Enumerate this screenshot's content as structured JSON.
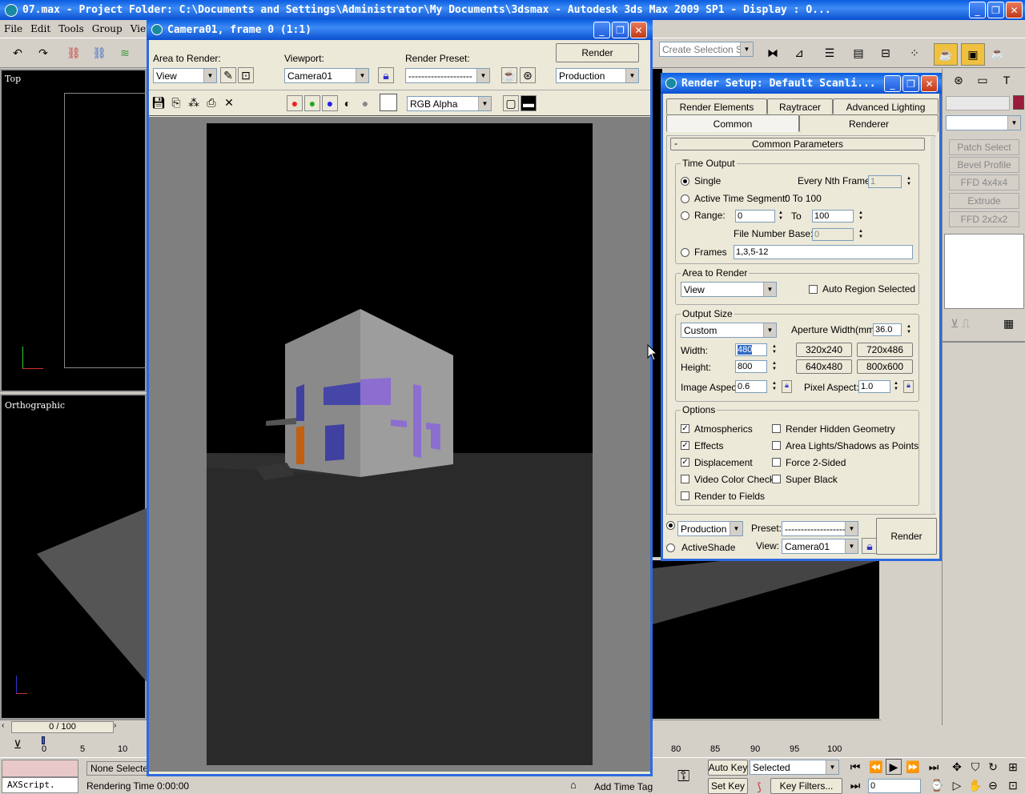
{
  "app": {
    "title": "07.max   - Project Folder: C:\\Documents and Settings\\Administrator\\My Documents\\3dsmax   - Autodesk 3ds Max  2009 SP1    - Display : O..."
  },
  "menu": [
    "File",
    "Edit",
    "Tools",
    "Group",
    "View"
  ],
  "toolbar": {
    "selection_set_placeholder": "Create Selection Set"
  },
  "viewports": {
    "top": "Top",
    "ortho": "Orthographic"
  },
  "side_panel": {
    "buttons": [
      "Patch Select",
      "Bevel Profile",
      "FFD 4x4x4",
      "Extrude",
      "FFD 2x2x2"
    ]
  },
  "frame_window": {
    "title": "Camera01, frame 0 (1:1)",
    "area_label": "Area to Render:",
    "area_value": "View",
    "viewport_label": "Viewport:",
    "viewport_value": "Camera01",
    "preset_label": "Render Preset:",
    "preset_value": "--------------------",
    "render_button": "Render",
    "mode_value": "Production",
    "channel_value": "RGB Alpha"
  },
  "render_setup": {
    "title": "Render Setup: Default Scanli...",
    "tabs_row1": [
      "Render Elements",
      "Raytracer",
      "Advanced Lighting"
    ],
    "tabs_row2": [
      "Common",
      "Renderer"
    ],
    "rollout": "Common Parameters",
    "time_output": {
      "title": "Time Output",
      "single": "Single",
      "nth_label": "Every Nth Frame:",
      "nth_value": "1",
      "active": "Active Time Segment:",
      "active_range": "0 To 100",
      "range": "Range:",
      "range_from": "0",
      "to": "To",
      "range_to": "100",
      "file_base": "File Number Base:",
      "file_base_value": "0",
      "frames": "Frames",
      "frames_value": "1,3,5-12"
    },
    "area": {
      "title": "Area to Render",
      "value": "View",
      "auto_region": "Auto Region Selected"
    },
    "output": {
      "title": "Output Size",
      "preset": "Custom",
      "aperture_label": "Aperture Width(mm):",
      "aperture": "36.0",
      "width_label": "Width:",
      "width": "480",
      "height_label": "Height:",
      "height": "800",
      "sizes": [
        "320x240",
        "720x486",
        "640x480",
        "800x600"
      ],
      "image_aspect_label": "Image Aspect:",
      "image_aspect": "0.6",
      "pixel_aspect_label": "Pixel Aspect:",
      "pixel_aspect": "1.0"
    },
    "options": {
      "title": "Options",
      "left": [
        {
          "label": "Atmospherics",
          "checked": true
        },
        {
          "label": "Effects",
          "checked": true
        },
        {
          "label": "Displacement",
          "checked": true
        },
        {
          "label": "Video Color Check",
          "checked": false
        },
        {
          "label": "Render to Fields",
          "checked": false
        }
      ],
      "right": [
        {
          "label": "Render Hidden Geometry",
          "checked": false
        },
        {
          "label": "Area Lights/Shadows as Points",
          "checked": false
        },
        {
          "label": "Force 2-Sided",
          "checked": false
        },
        {
          "label": "Super Black",
          "checked": false
        }
      ]
    },
    "bottom": {
      "production": "Production",
      "preset_label": "Preset:",
      "preset": "--------------------",
      "activeshade": "ActiveShade",
      "view_label": "View:",
      "view": "Camera01",
      "render": "Render"
    }
  },
  "timeline": {
    "slider": "0 / 100",
    "ticks_left": [
      "0",
      "5",
      "10"
    ],
    "ticks_right": [
      "80",
      "85",
      "90",
      "95",
      "100"
    ]
  },
  "status": {
    "maxscript": "AXScript.",
    "selection": "None Selected",
    "render_time": "Rendering Time  0:00:00",
    "add_time_tag": "Add Time Tag",
    "auto_key": "Auto Key",
    "set_key": "Set Key",
    "key_mode": "Selected",
    "key_filters": "Key Filters...",
    "frame": "0"
  }
}
